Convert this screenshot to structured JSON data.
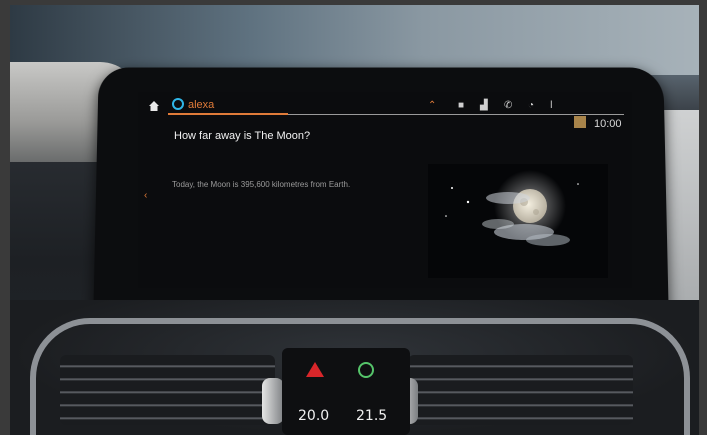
{
  "header": {
    "assistant_name": "alexa",
    "time": "10:00"
  },
  "icons": {
    "home": "home-icon",
    "alexa": "alexa-ring-icon",
    "status": [
      "chevron-up-icon",
      "message-icon",
      "signal-icon",
      "phone-icon",
      "wifi-icon",
      "mic-icon",
      "avatar-icon"
    ]
  },
  "conversation": {
    "question": "How far away is The Moon?",
    "answer": "Today, the Moon is 395,600 kilometres from Earth."
  },
  "climate": {
    "left_temp": "20.0",
    "right_temp": "21.5"
  },
  "colors": {
    "accent": "#e07b39",
    "alexa_blue": "#2fb6e8",
    "hazard": "#d8262a"
  }
}
